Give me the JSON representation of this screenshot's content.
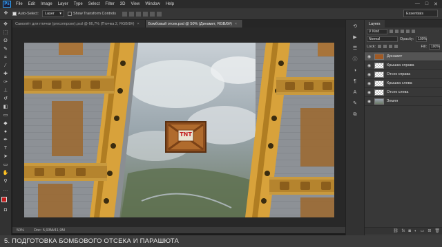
{
  "menubar": {
    "logo": "Ps",
    "items": [
      "File",
      "Edit",
      "Image",
      "Layer",
      "Type",
      "Select",
      "Filter",
      "3D",
      "View",
      "Window",
      "Help"
    ],
    "window_controls": [
      "—",
      "□",
      "✕"
    ]
  },
  "options": {
    "auto_select_label": "Auto-Select:",
    "auto_select_value": "Layer",
    "show_transform_label": "Show Transform Controls",
    "workspace": "Essentials"
  },
  "tabs": [
    {
      "label": "Самолёт для птички (precompose).psd @ 66,7% (Птичка 2, RGB/8#)",
      "close": "×"
    },
    {
      "label": "Бомбовый отсек.psd @ 50% (Динамит, RGB/8#)",
      "close": "×"
    }
  ],
  "statusbar": {
    "zoom": "50%",
    "doc": "Doc: 5,93M/41,9M"
  },
  "layers_panel": {
    "tab": "Layers",
    "kind_label": "Kind",
    "blend_mode": "Normal",
    "opacity_label": "Opacity:",
    "opacity_value": "100%",
    "lock_label": "Lock:",
    "fill_label": "Fill:",
    "fill_value": "100%",
    "layers": [
      {
        "name": "Динамит",
        "thumb": "tnt",
        "selected": true
      },
      {
        "name": "Крышка справа",
        "thumb": "checker",
        "selected": false
      },
      {
        "name": "Отсек справа",
        "thumb": "checker",
        "selected": false
      },
      {
        "name": "Крышка слева",
        "thumb": "checker",
        "selected": false
      },
      {
        "name": "Отсек слева",
        "thumb": "checker",
        "selected": false
      },
      {
        "name": "Земля",
        "thumb": "ground",
        "selected": false
      }
    ]
  },
  "canvas": {
    "crate_label": "TNT"
  },
  "caption": "5. ПОДГОТОВКА БОМБОВОГО ОТСЕКА И ПАРАШЮТА",
  "colors": {
    "foreground": "#c21b1b",
    "background": "#ffffff",
    "girder": "#d8a23b"
  },
  "icons": {
    "eye": "eye-icon",
    "move": "move-tool-icon"
  }
}
